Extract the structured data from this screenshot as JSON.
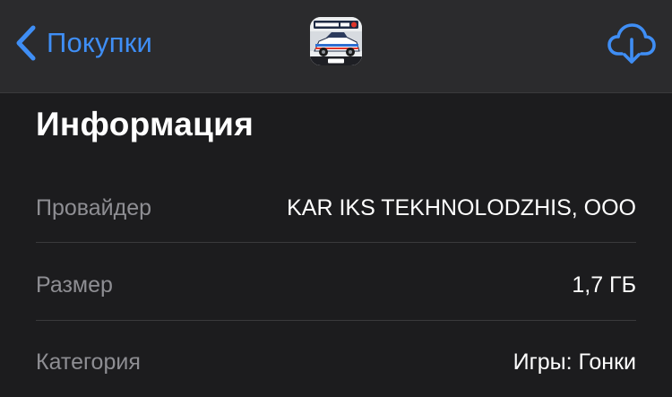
{
  "navbar": {
    "back_label": "Покупки",
    "app_icon": {
      "name": "app-icon",
      "text": "DRIFT RACING 2",
      "brand": "CarX"
    },
    "download_icon": "cloud-download-icon"
  },
  "info": {
    "title": "Информация",
    "rows": [
      {
        "label": "Провайдер",
        "value": "KAR IKS TEKHNOLODZHIS, OOO"
      },
      {
        "label": "Размер",
        "value": "1,7 ГБ"
      },
      {
        "label": "Категория",
        "value": "Игры: Гонки"
      }
    ]
  },
  "colors": {
    "accent": "#3f8ef5",
    "background": "#1c1c1e",
    "navbar": "#2b2b2d",
    "label": "#8e8e93",
    "value": "#ffffff",
    "divider": "#3a3a3c"
  }
}
